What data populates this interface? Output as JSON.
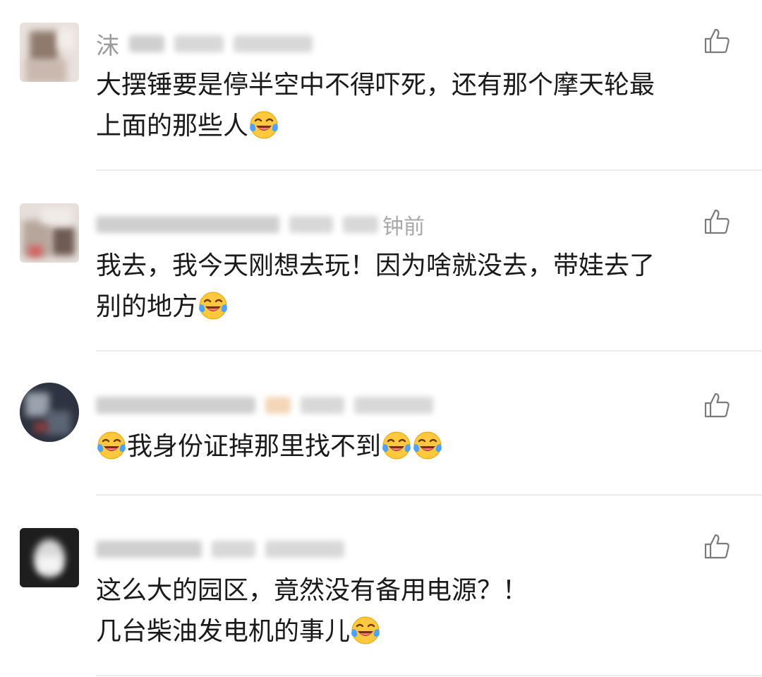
{
  "comments": [
    {
      "name": "沫",
      "time": "",
      "body_lines": [
        "大摆锤要是停半空中不得吓死，还有那个摩天轮最",
        "上面的那些人"
      ],
      "trailing_emojis": 1,
      "leading_emojis": 0,
      "avatar_colors": [
        "#c9b8ad",
        "#8f7a6d",
        "#e7dcd5"
      ]
    },
    {
      "name": "十",
      "time": "钟前",
      "body_lines": [
        "我去，我今天刚想去玩！因为啥就没去，带娃去了",
        "别的地方"
      ],
      "trailing_emojis": 1,
      "leading_emojis": 0,
      "avatar_colors": [
        "#d0c7c2",
        "#6e5b53",
        "#e8e1dd"
      ]
    },
    {
      "name": "",
      "time": "",
      "body_lines": [
        "我身份证掉那里找不到"
      ],
      "trailing_emojis": 2,
      "leading_emojis": 1,
      "avatar_colors": [
        "#2d3340",
        "#5c6574",
        "#9aa2ad"
      ]
    },
    {
      "name": "",
      "time": "",
      "body_lines": [
        "这么大的园区，竟然没有备用电源？！",
        "几台柴油发电机的事儿"
      ],
      "trailing_emojis": 1,
      "leading_emojis": 0,
      "avatar_colors": [
        "#1e1e1e",
        "#d9d9d9",
        "#444444"
      ]
    }
  ],
  "icons": {
    "like": "thumbs-up-icon",
    "emoji": "crying-laughing-face-icon"
  },
  "colors": {
    "text": "#1a1a1a",
    "meta": "#a8a8a8",
    "divider": "#ececec",
    "emoji_face": "#ffc83d",
    "emoji_tear": "#4aa3ff"
  }
}
